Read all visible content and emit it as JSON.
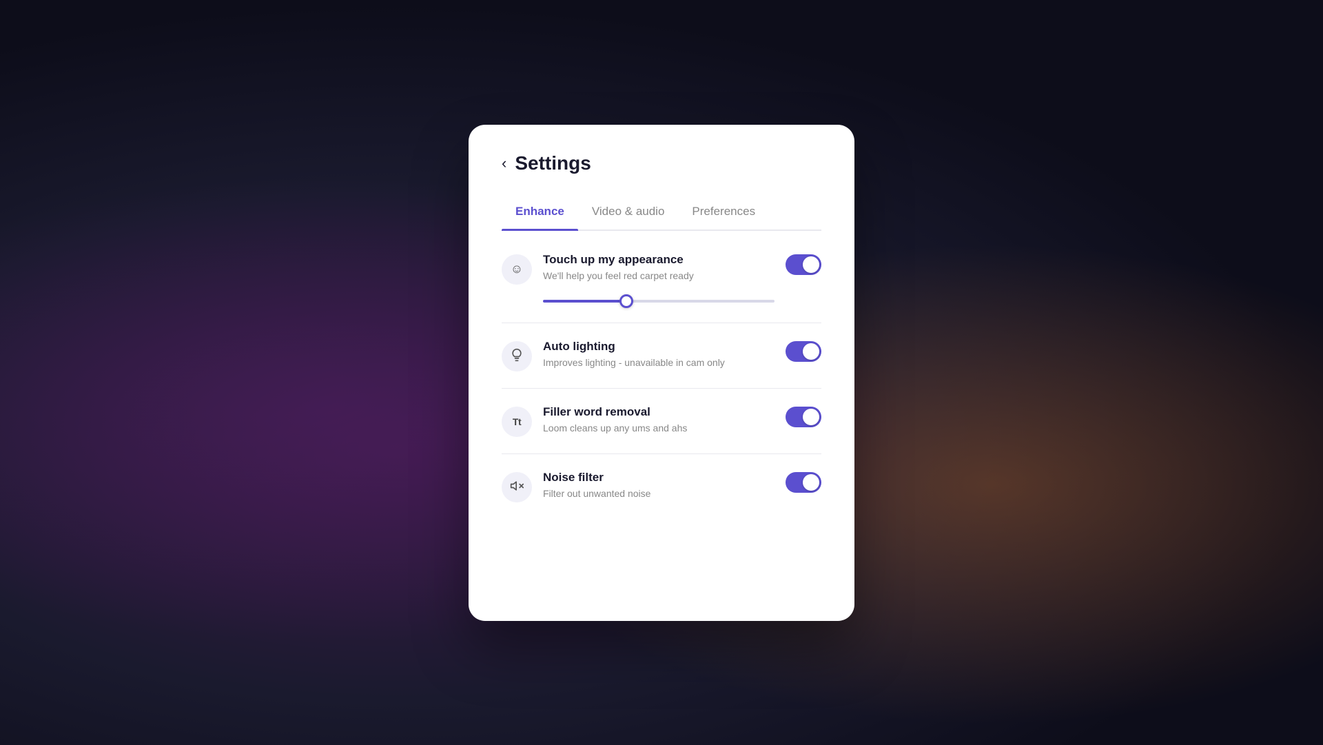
{
  "header": {
    "back_label": "‹",
    "title": "Settings"
  },
  "tabs": [
    {
      "id": "enhance",
      "label": "Enhance",
      "active": true
    },
    {
      "id": "video-audio",
      "label": "Video & audio",
      "active": false
    },
    {
      "id": "preferences",
      "label": "Preferences",
      "active": false
    }
  ],
  "settings": [
    {
      "id": "touch-up",
      "icon_type": "emoji",
      "icon": "☺",
      "title": "Touch up my appearance",
      "desc": "We'll help you feel red carpet ready",
      "has_slider": true,
      "slider_value": 35,
      "toggle_on": true
    },
    {
      "id": "auto-lighting",
      "icon_type": "bulb",
      "icon": "💡",
      "title": "Auto lighting",
      "desc": "Improves lighting - unavailable in cam only",
      "has_slider": false,
      "toggle_on": true
    },
    {
      "id": "filler-word",
      "icon_type": "text",
      "icon": "Tt",
      "title": "Filler word removal",
      "desc": "Loom cleans up any ums and ahs",
      "has_slider": false,
      "toggle_on": true
    },
    {
      "id": "noise-filter",
      "icon_type": "speaker",
      "icon": "🔇",
      "title": "Noise filter",
      "desc": "Filter out unwanted noise",
      "has_slider": false,
      "toggle_on": true
    }
  ],
  "colors": {
    "accent": "#5b4fcf",
    "toggle_on": "#5b4fcf",
    "icon_bg": "#f0f0f8"
  }
}
